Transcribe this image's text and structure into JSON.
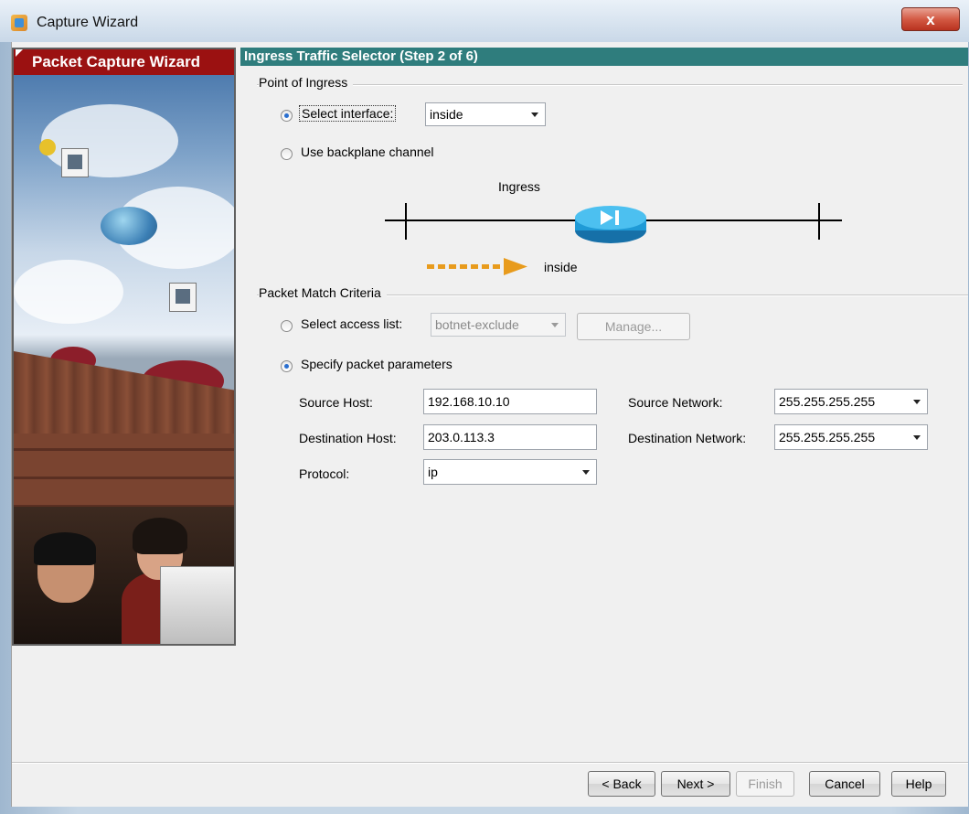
{
  "window": {
    "title": "Capture Wizard",
    "close_glyph": "x"
  },
  "sidebar": {
    "banner_title": "Packet Capture Wizard"
  },
  "step": {
    "header": "Ingress Traffic Selector   (Step 2 of 6)"
  },
  "ingress": {
    "group_title": "Point of Ingress",
    "select_interface_label": "Select interface:",
    "interface_value": "inside",
    "backplane_label": "Use backplane channel",
    "diagram_title": "Ingress",
    "diagram_direction_label": "inside"
  },
  "match": {
    "group_title": "Packet Match Criteria",
    "access_list_label": "Select access list:",
    "access_list_value": "botnet-exclude",
    "manage_label": "Manage...",
    "specify_label": "Specify packet parameters",
    "source_host_label": "Source Host:",
    "source_host_value": "192.168.10.10",
    "destination_host_label": "Destination Host:",
    "destination_host_value": "203.0.113.3",
    "protocol_label": "Protocol:",
    "protocol_value": "ip",
    "source_network_label": "Source Network:",
    "source_network_value": "255.255.255.255",
    "destination_network_label": "Destination Network:",
    "destination_network_value": "255.255.255.255"
  },
  "buttons": {
    "back": "< Back",
    "next": "Next >",
    "finish": "Finish",
    "cancel": "Cancel",
    "help": "Help"
  },
  "colors": {
    "step_header_bg": "#2f7d7d",
    "banner_bg": "#9b1111",
    "router_blue": "#1f9ad6",
    "arrow_orange": "#e89b1c"
  }
}
